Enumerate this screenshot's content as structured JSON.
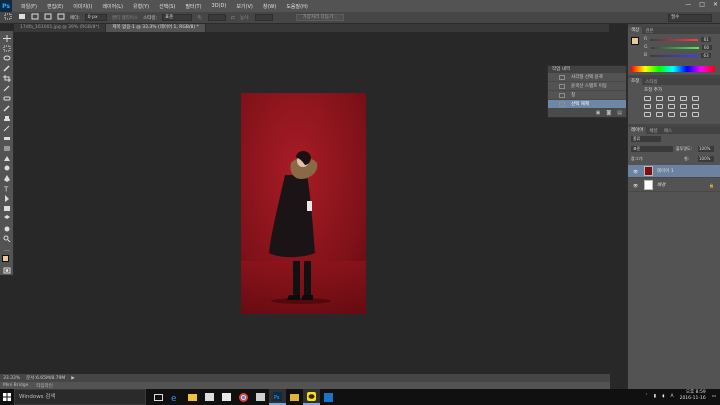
{
  "app": {
    "logo": "Ps"
  },
  "menu": [
    "파일(F)",
    "편집(E)",
    "이미지(I)",
    "레이어(L)",
    "유형(Y)",
    "선택(S)",
    "필터(T)",
    "3D(D)",
    "보기(V)",
    "창(W)",
    "도움말(H)"
  ],
  "window_controls": [
    "—",
    "□",
    "✕"
  ],
  "options": {
    "feather_label": "페더:",
    "feather_value": "0 px",
    "antialias_label": "앤티 앨리어스",
    "style_label": "스타일:",
    "style_value": "표준",
    "width_label": "폭:",
    "height_label": "높이:",
    "refine_button": "가장자리 다듬기...",
    "workspace": "필수"
  },
  "doc_tabs": [
    {
      "label": "17dfa_161001.jpg @ 39% (RGB/8*)",
      "active": false
    },
    {
      "label": "제목 없음-1 @ 33.3% (레이어 1, RGB/8) *",
      "active": true
    }
  ],
  "status": {
    "zoom": "33.33%",
    "doc_info": "문서:6.65M/8.79M",
    "arrow": "▶"
  },
  "bridge": {
    "minibridge": "Mini Bridge",
    "timeline": "타임라인"
  },
  "history": {
    "tabs": "작업 내역",
    "items": [
      {
        "label": "사각형 선택 윤곽",
        "selected": false
      },
      {
        "label": "윤곽선 스탬프 이동",
        "selected": false
      },
      {
        "label": "칠",
        "selected": false
      },
      {
        "label": "선택 해제",
        "selected": true
      }
    ]
  },
  "color_panel": {
    "tabs": [
      "색상",
      "견본"
    ],
    "sliders": [
      {
        "label": "R",
        "value": "61",
        "color": "#c85050"
      },
      {
        "label": "G",
        "value": "60",
        "color": "#50a050"
      },
      {
        "label": "B",
        "value": "63",
        "color": "#5060c8"
      }
    ]
  },
  "adjust_panel": {
    "tabs": [
      "조정",
      "스타일"
    ],
    "title": "조정 추가"
  },
  "layers_panel": {
    "tabs": [
      "레이어",
      "채널",
      "패스"
    ],
    "filter": "종류",
    "blend_mode": "표준",
    "opacity_label": "불투명도:",
    "opacity": "100%",
    "lock_label": "잠그기:",
    "fill_label": "칠:",
    "fill": "100%",
    "layers": [
      {
        "name": "레이어 1",
        "selected": true,
        "thumb": "#7a1016"
      },
      {
        "name": "배경",
        "selected": false,
        "thumb": "#ffffff"
      }
    ],
    "lock_icon": "🔒"
  },
  "taskbar": {
    "search": "Windows 검색",
    "apps": [
      "task-view-icon",
      "edge-icon",
      "file-explorer-icon",
      "store-icon",
      "mail-icon",
      "chrome-icon",
      "office-icon",
      "photoshop-icon",
      "explorer-icon",
      "kakaotalk-icon",
      "app-icon"
    ],
    "time": "오후 8:59",
    "date": "2016-11-16",
    "lang": "A"
  }
}
